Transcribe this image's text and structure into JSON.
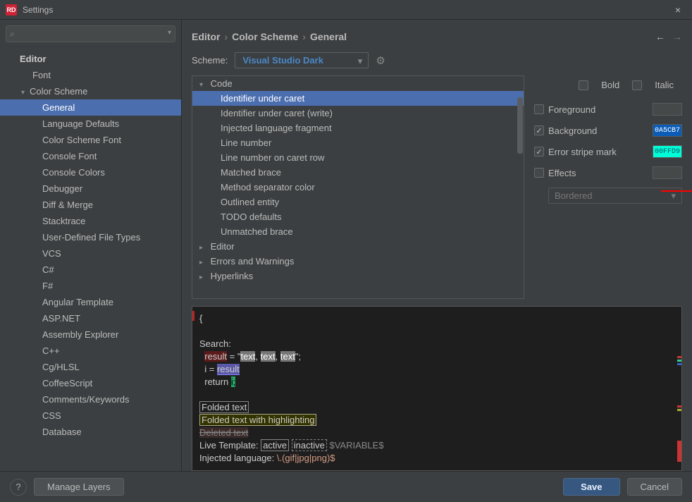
{
  "titlebar": {
    "app_badge": "RD",
    "title": "Settings",
    "close": "×"
  },
  "search": {
    "placeholder": ""
  },
  "sidebar": {
    "editor_label": "Editor",
    "font_label": "Font",
    "color_scheme_label": "Color Scheme",
    "items": [
      "General",
      "Language Defaults",
      "Color Scheme Font",
      "Console Font",
      "Console Colors",
      "Debugger",
      "Diff & Merge",
      "Stacktrace",
      "User-Defined File Types",
      "VCS",
      "C#",
      "F#",
      "Angular Template",
      "ASP.NET",
      "Assembly Explorer",
      "C++",
      "Cg/HLSL",
      "CoffeeScript",
      "Comments/Keywords",
      "CSS",
      "Database"
    ],
    "selected_index": 0
  },
  "breadcrumb": {
    "a": "Editor",
    "b": "Color Scheme",
    "c": "General"
  },
  "scheme": {
    "label": "Scheme:",
    "value": "Visual Studio Dark"
  },
  "attribute_tree": {
    "groups": [
      {
        "label": "Code",
        "expanded": true,
        "items": [
          "Identifier under caret",
          "Identifier under caret (write)",
          "Injected language fragment",
          "Line number",
          "Line number on caret row",
          "Matched brace",
          "Method separator color",
          "Outlined entity",
          "TODO defaults",
          "Unmatched brace"
        ]
      },
      {
        "label": "Editor",
        "expanded": false
      },
      {
        "label": "Errors and Warnings",
        "expanded": false
      },
      {
        "label": "Hyperlinks",
        "expanded": false
      }
    ],
    "selected": "Identifier under caret"
  },
  "options": {
    "bold": {
      "label": "Bold",
      "checked": false
    },
    "italic": {
      "label": "Italic",
      "checked": false
    },
    "foreground": {
      "label": "Foreground",
      "checked": false,
      "color": ""
    },
    "background": {
      "label": "Background",
      "checked": true,
      "color": "0A5CB7",
      "swatch": "#0A5CB7",
      "text_color": "#fff"
    },
    "error_stripe": {
      "label": "Error stripe mark",
      "checked": true,
      "color": "00FFD9",
      "swatch": "#00FFD9",
      "text_color": "#056"
    },
    "effects": {
      "label": "Effects",
      "checked": false,
      "dropdown": "Bordered"
    }
  },
  "preview": {
    "line1": "{",
    "search_label": "Search:",
    "l_result": "result",
    "l_eq": " = \"",
    "l_text1": "text",
    "l_c1": ", ",
    "l_text2": "text",
    "l_c2": ", ",
    "l_text3": "text",
    "l_end": "\";",
    "l_i": "i",
    "l_eq2": " = ",
    "l_result2": "result",
    "l_return": "return ",
    "l_i2": "i;",
    "folded1": "Folded text",
    "folded2": "Folded text with highlighting",
    "deleted": "Deleted text",
    "live_prefix": "Live Template: ",
    "live_active": "active",
    "live_inactive": "inactive",
    "live_var": " $VARIABLE$",
    "inj_prefix": "Injected language: ",
    "inj_re": "\\.(gif|jpg|png)$"
  },
  "footer": {
    "manage": "Manage Layers",
    "save": "Save",
    "cancel": "Cancel",
    "help": "?"
  }
}
